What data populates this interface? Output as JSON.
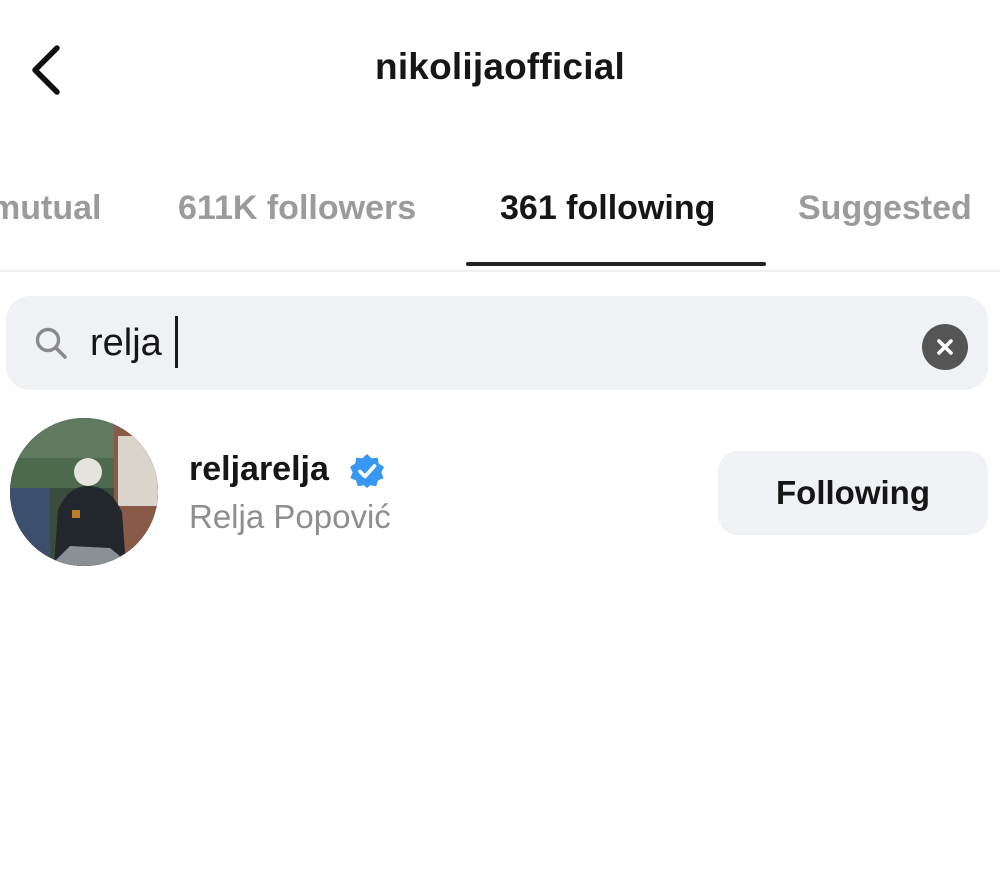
{
  "header": {
    "title": "nikolijaofficial",
    "back_icon": "chevron-left-icon"
  },
  "tabs": [
    {
      "label": "mutual",
      "active": false
    },
    {
      "label": "611K followers",
      "active": false
    },
    {
      "label": "361 following",
      "active": true
    },
    {
      "label": "Suggested",
      "active": false
    }
  ],
  "search": {
    "icon": "search-icon",
    "value": "relja",
    "clear_icon": "clear-icon"
  },
  "results": [
    {
      "username": "reljarelja",
      "verified": true,
      "full_name": "Relja Popović",
      "button_label": "Following"
    }
  ],
  "colors": {
    "verified_blue": "#3897f0",
    "secondary_text": "#8e8e8e",
    "inactive_tab": "#9b9b9b",
    "search_bg": "#eff1f4",
    "button_bg": "#eff1f4"
  }
}
